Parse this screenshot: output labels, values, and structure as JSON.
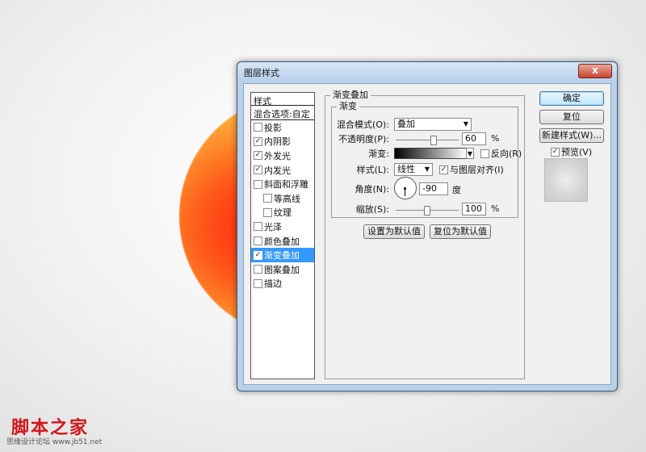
{
  "dialog": {
    "title": "图层样式",
    "close": "x"
  },
  "style_list": {
    "header": "样式",
    "blend": "混合选项:自定",
    "items": [
      {
        "label": "投影",
        "checked": false,
        "sub": false,
        "selected": false
      },
      {
        "label": "内阴影",
        "checked": true,
        "sub": false,
        "selected": false
      },
      {
        "label": "外发光",
        "checked": true,
        "sub": false,
        "selected": false
      },
      {
        "label": "内发光",
        "checked": true,
        "sub": false,
        "selected": false
      },
      {
        "label": "斜面和浮雕",
        "checked": false,
        "sub": false,
        "selected": false
      },
      {
        "label": "等高线",
        "checked": false,
        "sub": true,
        "selected": false
      },
      {
        "label": "纹理",
        "checked": false,
        "sub": true,
        "selected": false
      },
      {
        "label": "光泽",
        "checked": false,
        "sub": false,
        "selected": false
      },
      {
        "label": "颜色叠加",
        "checked": false,
        "sub": false,
        "selected": false
      },
      {
        "label": "渐变叠加",
        "checked": true,
        "sub": false,
        "selected": true
      },
      {
        "label": "图案叠加",
        "checked": false,
        "sub": false,
        "selected": false
      },
      {
        "label": "描边",
        "checked": false,
        "sub": false,
        "selected": false
      }
    ]
  },
  "panel": {
    "outer_title": "渐变叠加",
    "inner_title": "渐变",
    "blend_mode_label": "混合模式(O):",
    "blend_mode_value": "叠加",
    "opacity_label": "不透明度(P):",
    "opacity_value": "60",
    "opacity_fraction": 0.6,
    "percent": "%",
    "gradient_label": "渐变:",
    "reverse_label": "反向(R)",
    "reverse_checked": false,
    "style_label": "样式(L):",
    "style_value": "线性",
    "align_label": "与图层对齐(I)",
    "align_checked": true,
    "angle_label": "角度(N):",
    "angle_value": "-90",
    "degree_unit": "度",
    "scale_label": "缩放(S):",
    "scale_value": "100",
    "scale_fraction": 0.5,
    "set_default": "设置为默认值",
    "reset_default": "复位为默认值"
  },
  "buttons": {
    "ok": "确定",
    "reset": "复位",
    "new_style": "新建样式(W)...",
    "preview_label": "预览(V)",
    "preview_checked": true
  },
  "watermark": {
    "title": "脚本之家",
    "sub": "思缘设计论坛 www.jb51.net"
  },
  "colors": {
    "selection": "#3399ff",
    "titlebar": "#b8d0ea"
  }
}
